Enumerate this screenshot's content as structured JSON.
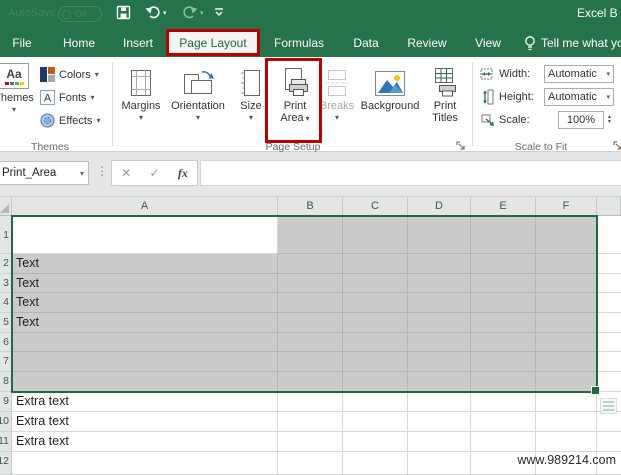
{
  "icons": {
    "caret": "▾",
    "dots": "⋮",
    "cancel": "✕",
    "check": "✓",
    "fx": "fx",
    "spin_up": "▲",
    "spin_down": "▼",
    "themes_aa": "Aa",
    "fonts_a": "A"
  },
  "titlebar": {
    "autosave_label": "AutoSave",
    "autosave_state": "Off",
    "doc_title": "Excel B"
  },
  "tabs": {
    "items": [
      "File",
      "Home",
      "Insert",
      "Page Layout",
      "Formulas",
      "Data",
      "Review",
      "View"
    ],
    "tell_me": "Tell me what yo"
  },
  "ribbon": {
    "groups": {
      "themes": "Themes",
      "page_setup": "Page Setup",
      "scale_to_fit": "Scale to Fit"
    },
    "themes": {
      "button": "Themes",
      "colors": "Colors",
      "fonts": "Fonts",
      "effects": "Effects"
    },
    "page_setup": {
      "margins": "Margins",
      "orientation": "Orientation",
      "size": "Size",
      "print_area": "Print Area",
      "breaks": "Breaks",
      "background": "Background",
      "print_titles": "Print Titles"
    },
    "scale": {
      "width_label": "Width:",
      "width_value": "Automatic",
      "height_label": "Height:",
      "height_value": "Automatic",
      "scale_label": "Scale:",
      "scale_value": "100%"
    }
  },
  "formula_bar": {
    "name_box": "Print_Area",
    "value": ""
  },
  "grid": {
    "columns": [
      "A",
      "B",
      "C",
      "D",
      "E",
      "F"
    ],
    "row_numbers": [
      "1",
      "2",
      "3",
      "4",
      "5",
      "6",
      "7",
      "8",
      "9",
      "10",
      "11",
      "12"
    ],
    "cells": {
      "a2": "Text",
      "a3": "Text",
      "a4": "Text",
      "a5": "Text",
      "a9": "Extra text",
      "a10": "Extra text",
      "a11": "Extra text"
    }
  },
  "watermark": "www.989214.com",
  "colors": {
    "excel_green": "#26724A",
    "annotation_red": "#C00000",
    "selection_fill": "#CBCBCB",
    "selection_border": "#1E6B41"
  }
}
